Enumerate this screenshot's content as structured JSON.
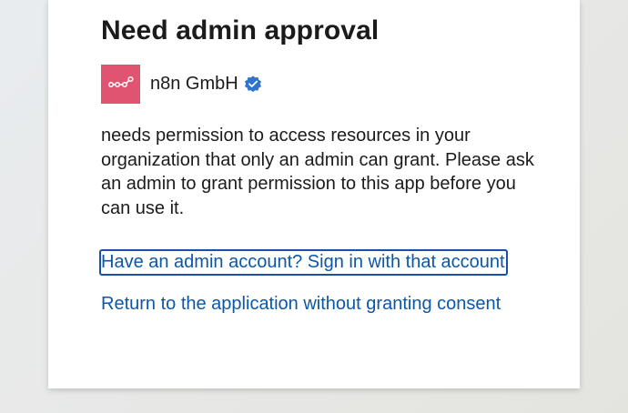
{
  "dialog": {
    "title": "Need admin approval",
    "app_name": "n8n GmbH",
    "app_logo_icon": "workflow-nodes-icon",
    "verified_icon": "verified-badge-icon",
    "description": "needs permission to access resources in your organization that only an admin can grant. Please ask an admin to grant permission to this app before you can use it.",
    "admin_link": "Have an admin account? Sign in with that account",
    "return_link": "Return to the application without granting consent"
  },
  "colors": {
    "app_logo_bg": "#df5571",
    "link": "#0b57a8",
    "verified_badge": "#2f74d0",
    "focus_outline": "#1a4fa3"
  }
}
